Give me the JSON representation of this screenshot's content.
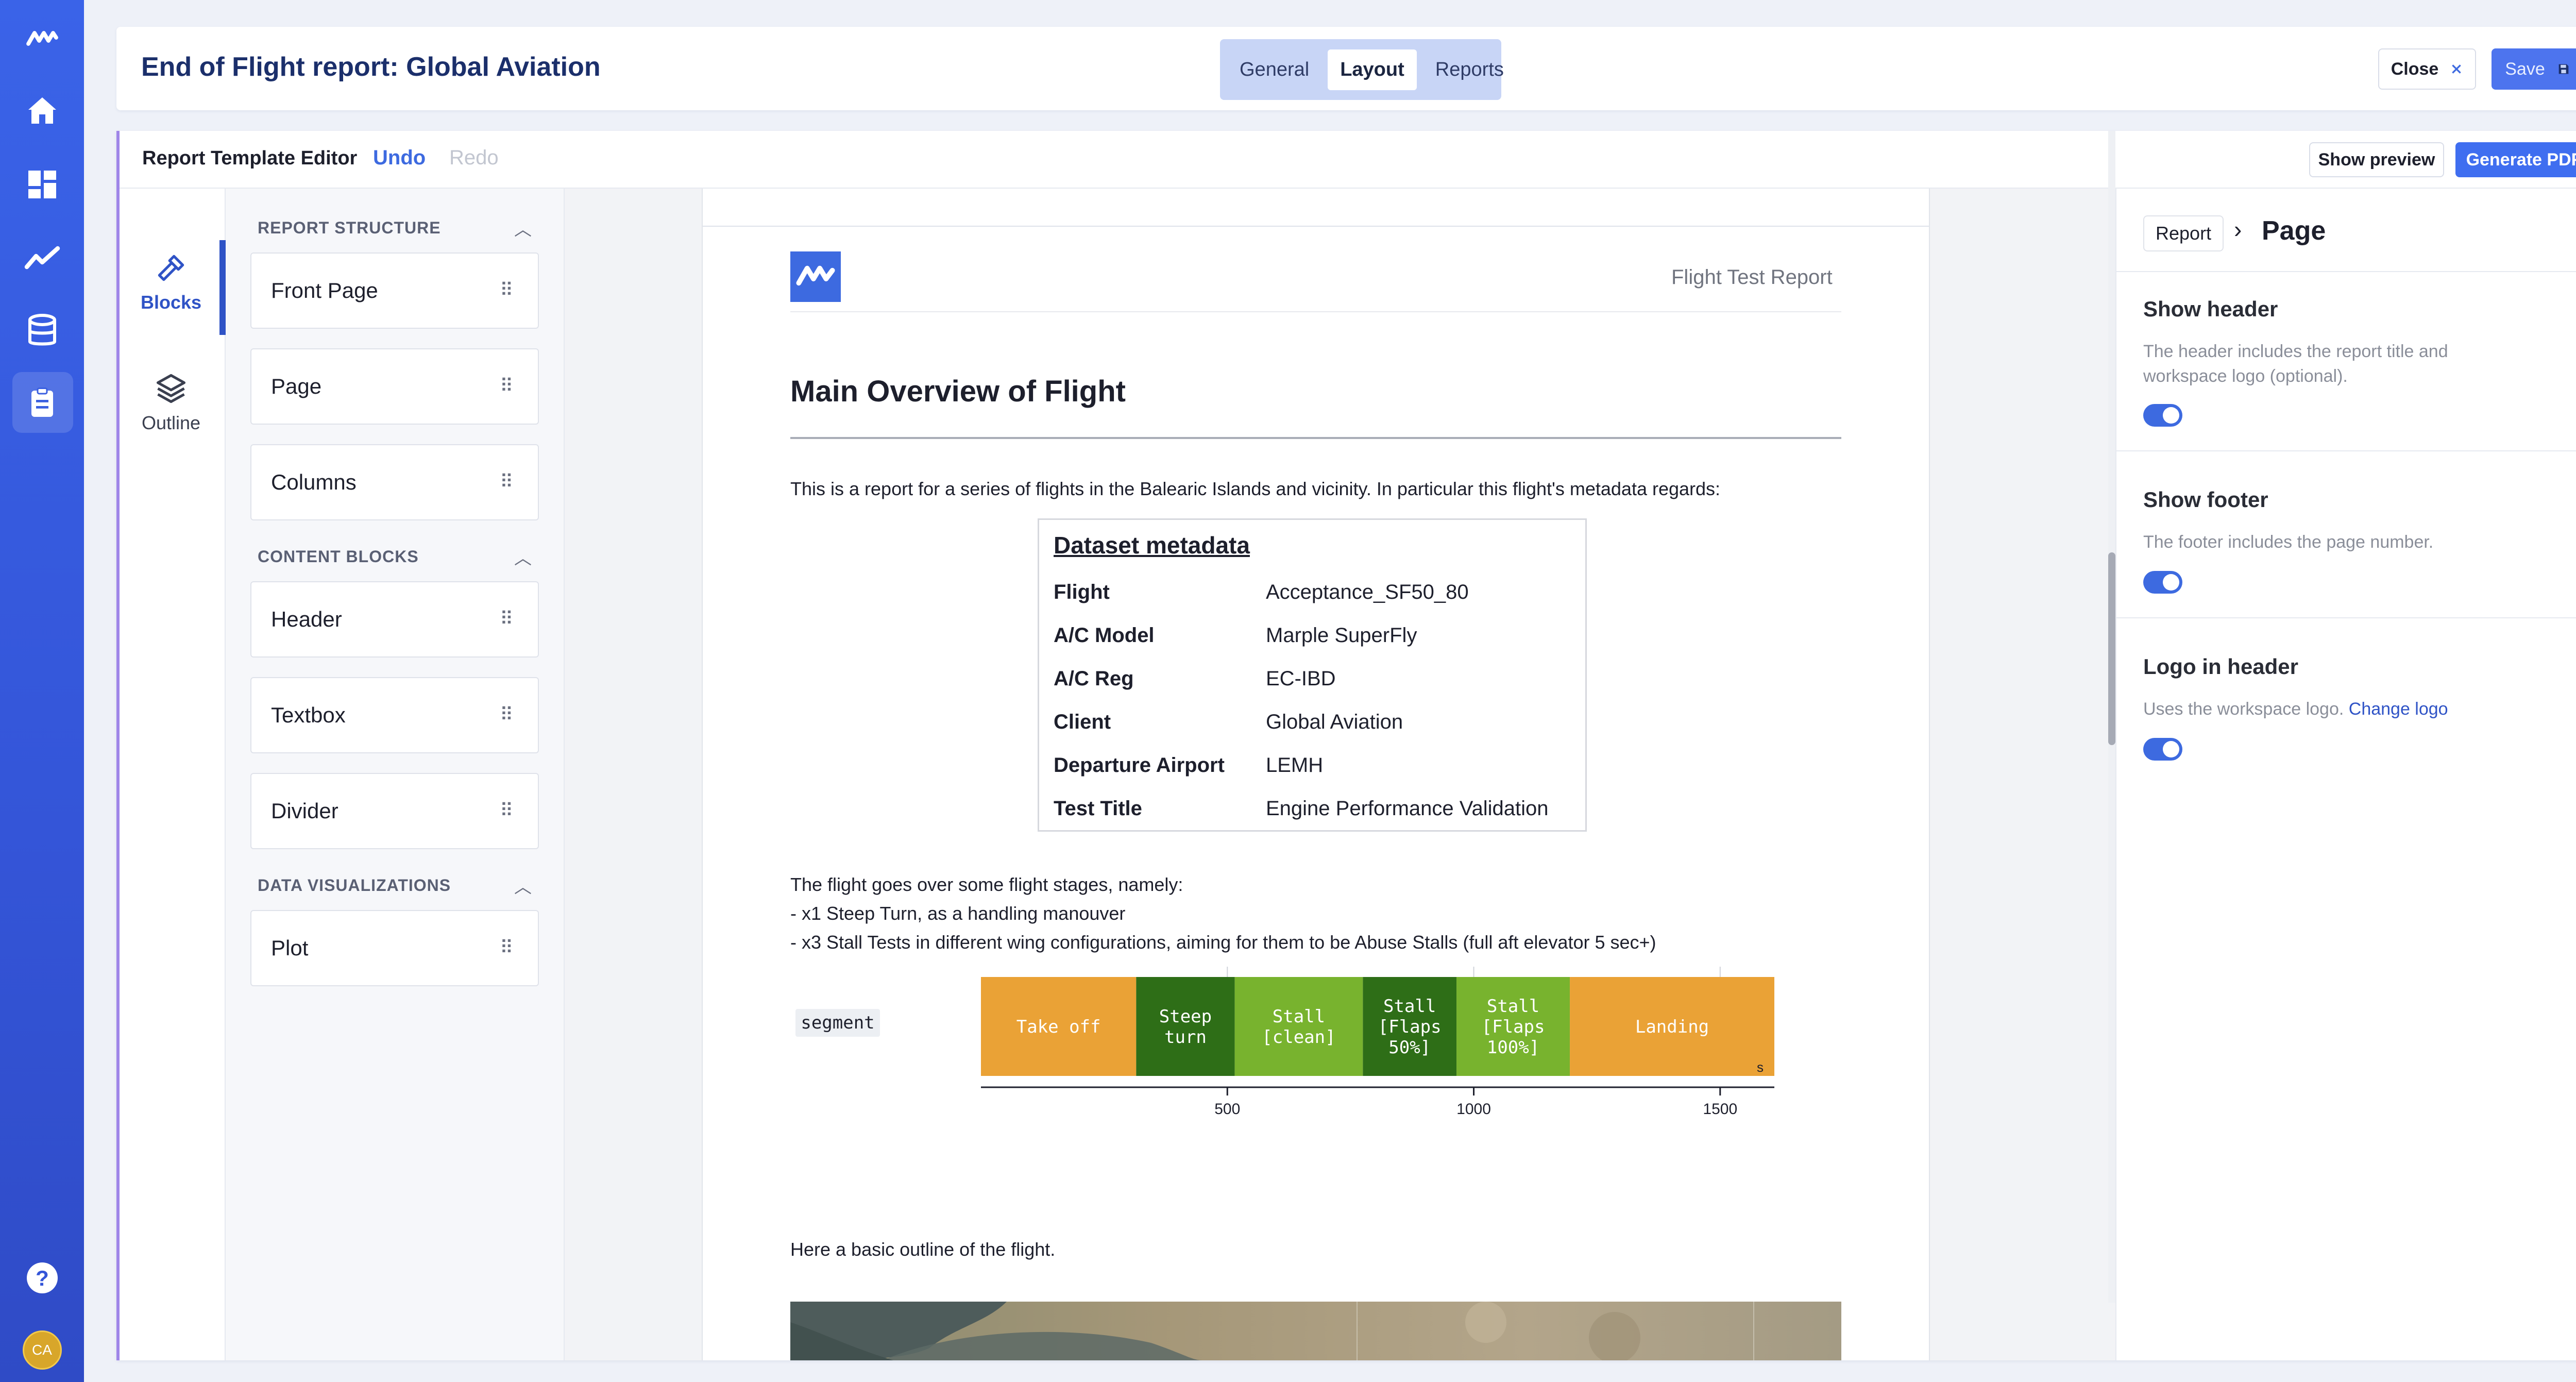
{
  "rail": {
    "logo_icon": "marple-logo",
    "items": [
      "home-icon",
      "dashboard-icon",
      "analytics-icon",
      "database-icon",
      "reports-icon"
    ],
    "bottom": [
      "help-icon",
      "avatar"
    ],
    "avatar_initials": "CA"
  },
  "header": {
    "title": "End of Flight report: Global Aviation",
    "tabs": [
      {
        "label": "General",
        "active": false
      },
      {
        "label": "Layout",
        "active": true
      },
      {
        "label": "Reports",
        "active": false
      }
    ],
    "close_label": "Close",
    "save_label": "Save"
  },
  "toolbar": {
    "title": "Report Template Editor",
    "undo": "Undo",
    "redo": "Redo",
    "show_preview": "Show preview",
    "generate_pdf": "Generate PDF"
  },
  "editor_nav": {
    "blocks": "Blocks",
    "outline": "Outline"
  },
  "blocks_panel": {
    "report_structure": {
      "heading": "REPORT STRUCTURE",
      "items": [
        "Front Page",
        "Page",
        "Columns"
      ]
    },
    "content_blocks": {
      "heading": "CONTENT BLOCKS",
      "items": [
        "Header",
        "Textbox",
        "Divider"
      ]
    },
    "data_visualizations": {
      "heading": "DATA VISUALIZATIONS",
      "items": [
        "Plot"
      ]
    }
  },
  "document": {
    "header_title": "Flight Test Report",
    "h1": "Main Overview of Flight",
    "intro": "This is a report for a series of flights in the Balearic Islands and vicinity. In particular this flight's metadata regards:",
    "metadata": {
      "title": "Dataset metadata",
      "rows": [
        {
          "key": "Flight",
          "value": "Acceptance_SF50_80"
        },
        {
          "key": "A/C Model",
          "value": "Marple SuperFly"
        },
        {
          "key": "A/C Reg",
          "value": "EC-IBD"
        },
        {
          "key": "Client",
          "value": "Global Aviation"
        },
        {
          "key": "Departure Airport",
          "value": "LEMH"
        },
        {
          "key": "Test Title",
          "value": "Engine Performance Validation"
        }
      ]
    },
    "stages_line1": "The flight goes over some flight stages, namely:",
    "stages_line2": "- x1 Steep Turn, as a handling manouver",
    "stages_line3": "- x3 Stall Tests in different wing configurations, aiming for them to be Abuse Stalls (full aft elevator 5 sec+)",
    "segment_chip": "segment",
    "outline_text": "Here a basic outline of the flight."
  },
  "chart_data": {
    "type": "bar",
    "orientation": "horizontal-timeline",
    "series_name": "segment",
    "xlim": [
      0,
      1610
    ],
    "x_ticks": [
      500,
      1000,
      1500
    ],
    "x_unit": "s",
    "segments": [
      {
        "label": "Take off",
        "start": 0,
        "end": 315,
        "color": "#eaa236"
      },
      {
        "label": "Steep turn",
        "start": 315,
        "end": 515,
        "color": "#2e6e17"
      },
      {
        "label": "Stall [clean]",
        "start": 515,
        "end": 775,
        "color": "#78b32e"
      },
      {
        "label": "Stall [Flaps 50%]",
        "start": 775,
        "end": 965,
        "color": "#2e6e17"
      },
      {
        "label": "Stall [Flaps 100%]",
        "start": 965,
        "end": 1195,
        "color": "#78b32e"
      },
      {
        "label": "Landing",
        "start": 1195,
        "end": 1610,
        "color": "#eaa236"
      }
    ]
  },
  "right_panel": {
    "crumb_parent": "Report",
    "crumb_current": "Page",
    "show_header": {
      "title": "Show header",
      "desc": "The header includes the report title and workspace logo (optional).",
      "enabled": true
    },
    "show_footer": {
      "title": "Show footer",
      "desc": "The footer includes the page number.",
      "enabled": true
    },
    "logo_in_header": {
      "title": "Logo in header",
      "desc": "Uses the workspace logo.",
      "link": "Change logo",
      "enabled": true
    }
  },
  "colors": {
    "accent": "#3d6ae0",
    "rail": "#3a63e8",
    "save": "#4d74ee",
    "tab_bg": "#c8d5f6",
    "outline_left": "#9f86e8"
  }
}
